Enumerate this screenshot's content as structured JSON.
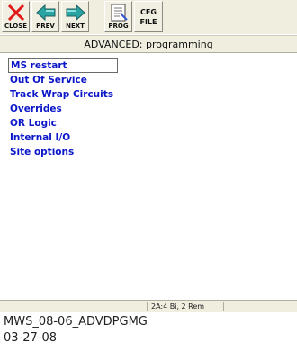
{
  "toolbar": {
    "close_label": "CLOSE",
    "prev_label": "PREV",
    "next_label": "NEXT",
    "prog_label": "PROG",
    "cfg_line1": "CFG",
    "cfg_line2": "FILE"
  },
  "header": {
    "title": "ADVANCED: programming"
  },
  "menu": {
    "items": [
      {
        "label": "MS restart",
        "selected": true
      },
      {
        "label": "Out Of Service"
      },
      {
        "label": "Track Wrap Circuits"
      },
      {
        "label": "Overrides"
      },
      {
        "label": "OR Logic"
      },
      {
        "label": "Internal I/O"
      },
      {
        "label": "Site options"
      }
    ]
  },
  "status": {
    "text": "2A:4 Bi, 2 Rem"
  },
  "caption": {
    "line1": "MWS_08-06_ADVDPGMG",
    "line2": "03-27-08"
  },
  "colors": {
    "menu_text": "#0a16c8",
    "toolbar_bg": "#f0eedf",
    "close_red": "#e01818",
    "arrow_teal": "#1f8a8a"
  },
  "icons": {
    "close": "close-x-icon",
    "prev": "left-arrow-icon",
    "next": "right-arrow-icon",
    "prog": "document-icon"
  }
}
